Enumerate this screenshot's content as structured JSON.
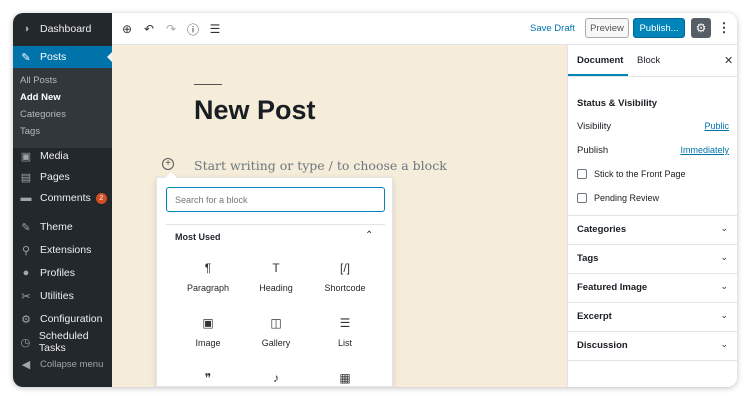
{
  "sidebar": {
    "items": [
      {
        "name": "dashboard",
        "label": "Dashboard",
        "icon": "dashboard-icon",
        "glyph": "◑"
      },
      {
        "name": "posts",
        "label": "Posts",
        "icon": "pin-icon",
        "glyph": "✎",
        "active": true
      },
      {
        "name": "media",
        "label": "Media",
        "icon": "media-icon",
        "glyph": "▣"
      },
      {
        "name": "pages",
        "label": "Pages",
        "icon": "pages-icon",
        "glyph": "▤"
      },
      {
        "name": "comments",
        "label": "Comments",
        "icon": "comment-icon",
        "glyph": "▬",
        "badge": "2"
      },
      {
        "name": "theme",
        "label": "Theme",
        "icon": "brush-icon",
        "glyph": "✎"
      },
      {
        "name": "extensions",
        "label": "Extensions",
        "icon": "plugin-icon",
        "glyph": "⚲"
      },
      {
        "name": "profiles",
        "label": "Profiles",
        "icon": "user-icon",
        "glyph": "●"
      },
      {
        "name": "utilities",
        "label": "Utilities",
        "icon": "wrench-icon",
        "glyph": "✂"
      },
      {
        "name": "configuration",
        "label": "Configuration",
        "icon": "settings-icon",
        "glyph": "⚙"
      },
      {
        "name": "scheduled-tasks",
        "label": "Scheduled Tasks",
        "icon": "clock-icon",
        "glyph": "◷"
      }
    ],
    "submenu": [
      "All Posts",
      "Add New",
      "Categories",
      "Tags"
    ],
    "submenu_current": "Add New",
    "collapse_label": "Collapse menu"
  },
  "toolbar": {
    "save_draft": "Save Draft",
    "preview": "Preview",
    "publish": "Publish..."
  },
  "editor": {
    "title": "New Post",
    "placeholder": "Start writing or type / to choose a block"
  },
  "inserter": {
    "search_placeholder": "Search for a block",
    "section_label": "Most Used",
    "blocks": [
      {
        "label": "Paragraph",
        "icon": "paragraph-icon",
        "glyph": "¶"
      },
      {
        "label": "Heading",
        "icon": "heading-icon",
        "glyph": "T"
      },
      {
        "label": "Shortcode",
        "icon": "shortcode-icon",
        "glyph": "[/]"
      },
      {
        "label": "Image",
        "icon": "image-icon",
        "glyph": "▣"
      },
      {
        "label": "Gallery",
        "icon": "gallery-icon",
        "glyph": "◫"
      },
      {
        "label": "List",
        "icon": "list-icon",
        "glyph": "☰"
      },
      {
        "label": "",
        "icon": "quote-icon",
        "glyph": "❞"
      },
      {
        "label": "",
        "icon": "audio-icon",
        "glyph": "♪"
      },
      {
        "label": "",
        "icon": "cover-icon",
        "glyph": "▦"
      }
    ]
  },
  "panel": {
    "tabs": [
      "Document",
      "Block"
    ],
    "status_heading": "Status & Visibility",
    "visibility_label": "Visibility",
    "visibility_value": "Public",
    "publish_label": "Publish",
    "publish_value": "Immediately",
    "stick_label": "Stick to the Front Page",
    "pending_label": "Pending Review",
    "sections": [
      "Categories",
      "Tags",
      "Featured Image",
      "Excerpt",
      "Discussion"
    ]
  },
  "colors": {
    "sidebar_bg": "#23282d",
    "active_bg": "#0073aa",
    "publish_bg": "#0085ba",
    "editor_bg": "#f5ecd9",
    "badge_bg": "#d54e21"
  }
}
